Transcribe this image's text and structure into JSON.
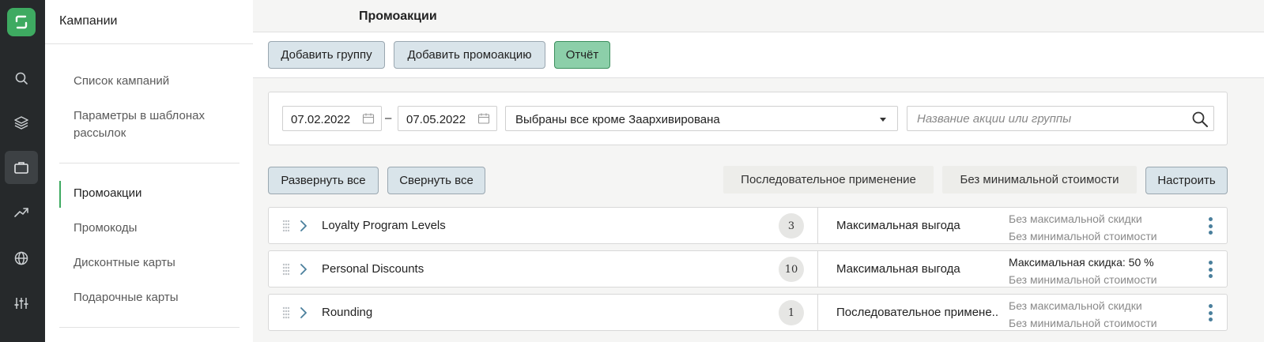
{
  "rail": {
    "icons": [
      "logo-icon",
      "search-icon",
      "layers-icon",
      "briefcase-icon",
      "trending-up-icon",
      "globe-icon",
      "sliders-icon"
    ],
    "active": "briefcase-icon",
    "accent": "#3eaa61"
  },
  "sidebar": {
    "title": "Кампании",
    "items": [
      {
        "label": "Список кампаний"
      },
      {
        "label": "Параметры в шаблонах рассылок"
      },
      {
        "label": "Промоакции",
        "active": true
      },
      {
        "label": "Промокоды"
      },
      {
        "label": "Дисконтные карты"
      },
      {
        "label": "Подарочные карты"
      }
    ]
  },
  "page": {
    "title": "Промоакции"
  },
  "toolbar": {
    "add_group": "Добавить группу",
    "add_promo": "Добавить промоакцию",
    "report": "Отчёт"
  },
  "filters": {
    "date_from": "07.02.2022",
    "date_separator": "–",
    "date_to": "07.05.2022",
    "status_select": "Выбраны все кроме Заархивирована",
    "search_placeholder": "Название акции или группы"
  },
  "list_controls": {
    "expand_all": "Развернуть все",
    "collapse_all": "Свернуть все",
    "sequential_chip": "Последовательное применение",
    "min_cost_chip": "Без минимальной стоимости",
    "configure": "Настроить"
  },
  "groups": [
    {
      "name": "Loyalty Program Levels",
      "count": "3",
      "mode": "Максимальная выгода",
      "line1": "Без максимальной скидки",
      "line2": "Без минимальной стоимости"
    },
    {
      "name": "Personal Discounts",
      "count": "10",
      "mode": "Максимальная выгода",
      "line1": "Максимальная скидка: 50 %",
      "line2": "Без минимальной стоимости"
    },
    {
      "name": "Rounding",
      "count": "1",
      "mode": "Последовательное примене...",
      "line1": "Без максимальной скидки",
      "line2": "Без минимальной стоимости"
    }
  ]
}
